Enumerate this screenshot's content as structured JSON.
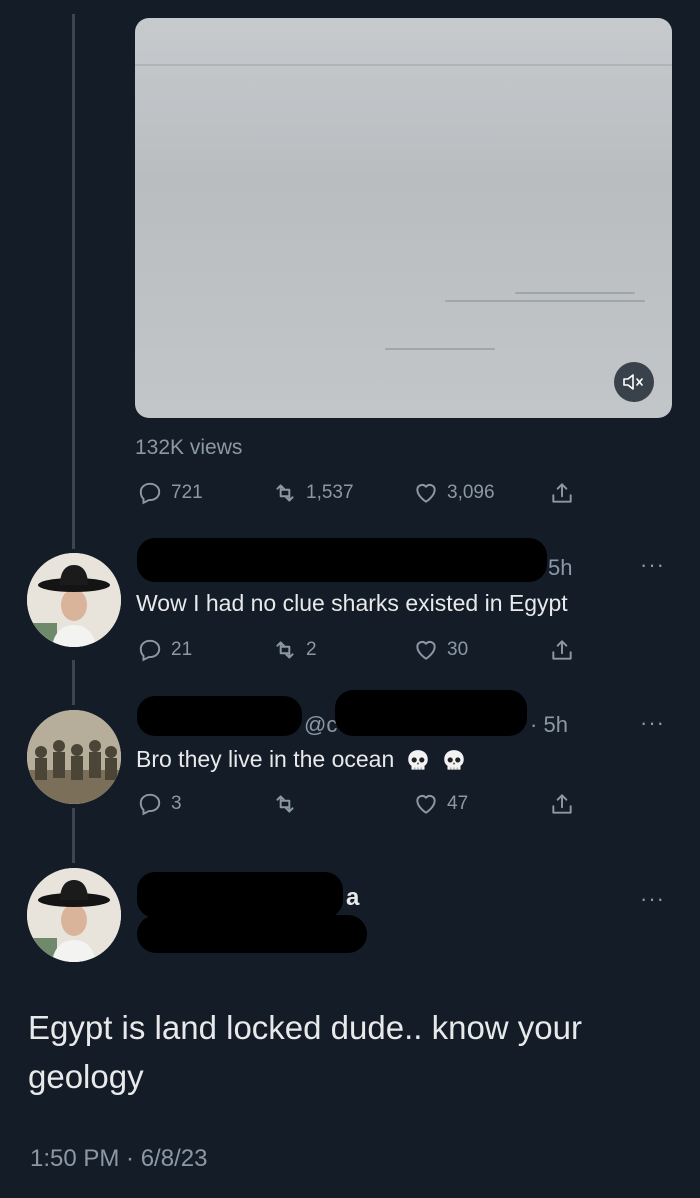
{
  "main_tweet": {
    "views": "132K views",
    "replies": "721",
    "retweets": "1,537",
    "likes": "3,096"
  },
  "replies": [
    {
      "time": "5h",
      "text": "Wow I had no clue sharks existed in Egypt",
      "replies": "21",
      "retweets": "2",
      "likes": "30"
    },
    {
      "handle_visible": "@c",
      "time": "5h",
      "text": "Bro they live in the ocean",
      "replies": "3",
      "retweets": "",
      "likes": "47"
    }
  ],
  "focused_tweet": {
    "name_fragment": "a",
    "text": "Egypt is land locked dude.. know your geology",
    "timestamp": "1:50 PM · 6/8/23"
  },
  "more_label": "···",
  "icons": {
    "mute": "volume-muted-icon",
    "reply": "reply-icon",
    "retweet": "retweet-icon",
    "like": "heart-icon",
    "share": "share-icon",
    "emoji": "skull-emoji"
  }
}
